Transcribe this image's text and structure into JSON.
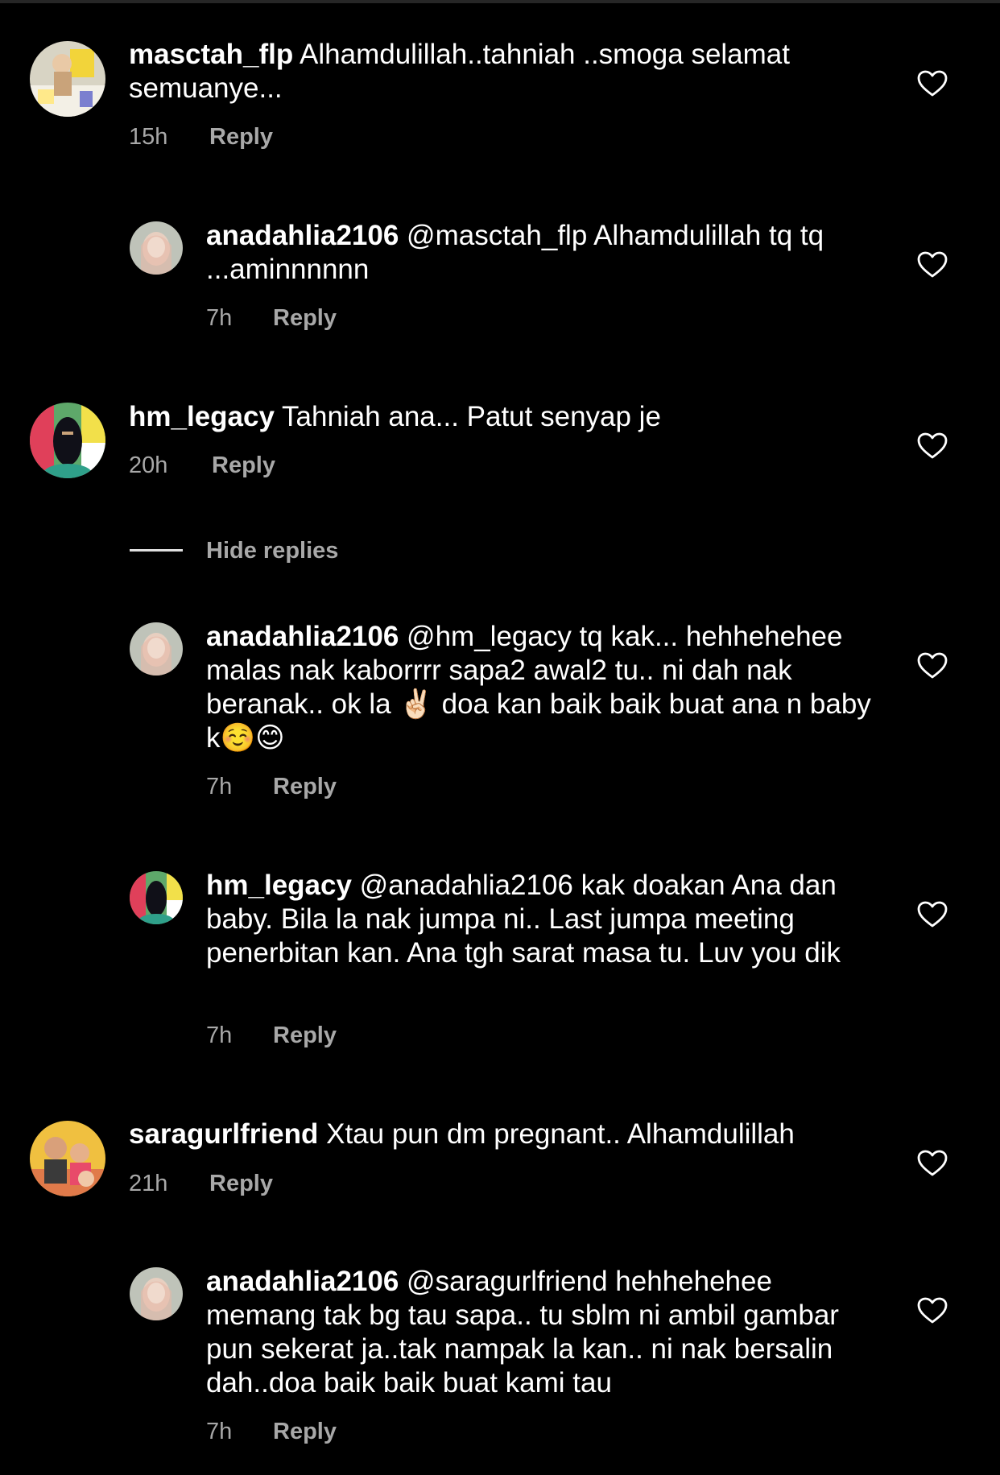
{
  "comments": [
    {
      "username": "masctah_flp",
      "text": "Alhamdulillah..tahniah ..smoga selamat semuanye...",
      "time": "15h",
      "reply_label": "Reply"
    },
    {
      "username": "anadahlia2106",
      "text": "@masctah_flp Alhamdulillah tq tq ...aminnnnnn",
      "time": "7h",
      "reply_label": "Reply"
    },
    {
      "username": "hm_legacy",
      "text": "Tahniah ana... Patut senyap je",
      "time": "20h",
      "reply_label": "Reply"
    },
    {
      "username": "anadahlia2106",
      "text": "@hm_legacy tq kak... hehhehehee malas nak kaborrrr sapa2 awal2 tu.. ni dah nak beranak.. ok la ✌🏻 doa kan baik baik buat ana n baby k☺️😊",
      "time": "7h",
      "reply_label": "Reply"
    },
    {
      "username": "hm_legacy",
      "text": "@anadahlia2106 kak doakan Ana dan baby. Bila la nak jumpa ni.. Last jumpa meeting penerbitan kan. Ana tgh sarat masa tu. Luv you dik",
      "time": "7h",
      "reply_label": "Reply"
    },
    {
      "username": "saragurlfriend",
      "text": "Xtau pun dm pregnant.. Alhamdulillah",
      "time": "21h",
      "reply_label": "Reply"
    },
    {
      "username": "anadahlia2106",
      "text": "@saragurlfriend hehhehehee memang tak bg tau sapa.. tu sblm ni ambil gambar pun sekerat ja..tak nampak la kan.. ni nak bersalin dah..doa baik baik buat kami tau",
      "time": "7h",
      "reply_label": "Reply"
    }
  ],
  "thread": {
    "hide_replies_label": "Hide replies"
  },
  "icons": {
    "like": "heart-outline-icon"
  },
  "colors": {
    "background": "#000000",
    "text": "#ffffff",
    "secondary": "#a8a8a8"
  }
}
